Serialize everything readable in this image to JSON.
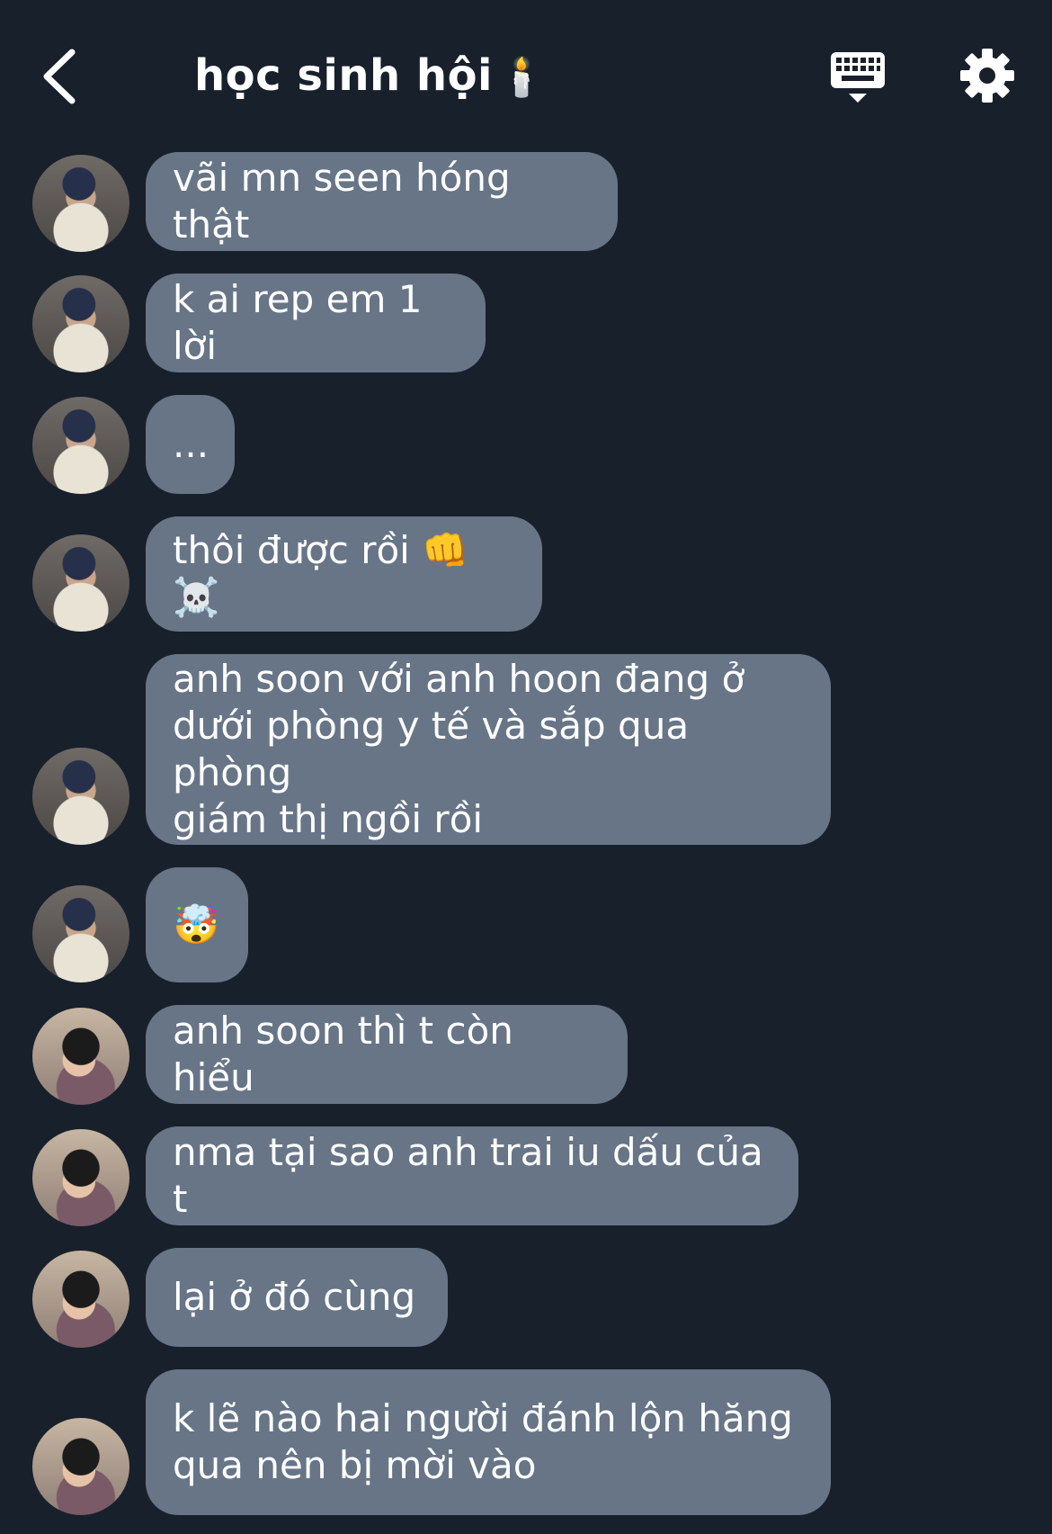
{
  "header": {
    "title": "học sinh hội",
    "title_emoji": "🕯️",
    "back_icon": "chevron-left-icon",
    "keyboard_icon": "keyboard-icon",
    "settings_icon": "gear-icon"
  },
  "messages": [
    {
      "text": "vãi mn seen hóng thật",
      "sender": "a1"
    },
    {
      "text": "k ai rep em 1 lời",
      "sender": "a1"
    },
    {
      "text": "...",
      "sender": "a1"
    },
    {
      "text": "thôi được rồi 👊 ☠️",
      "sender": "a1"
    },
    {
      "text": "anh soon với anh hoon đang ở\ndưới phòng y tế và sắp qua phòng\ngiám thị ngồi rồi",
      "sender": "a1"
    },
    {
      "text": "🤯",
      "sender": "a1"
    },
    {
      "text": "anh soon thì t còn hiểu",
      "sender": "a2"
    },
    {
      "text": "nma tại sao anh trai iu dấu của t",
      "sender": "a2"
    },
    {
      "text": "lại ở đó cùng",
      "sender": "a2"
    },
    {
      "text": "k lẽ nào hai người đánh lộn hăng\nqua nên bị mời vào",
      "sender": "a2"
    }
  ],
  "colors": {
    "background": "#18202c",
    "bubble": "#677587",
    "text": "#ffffff"
  }
}
